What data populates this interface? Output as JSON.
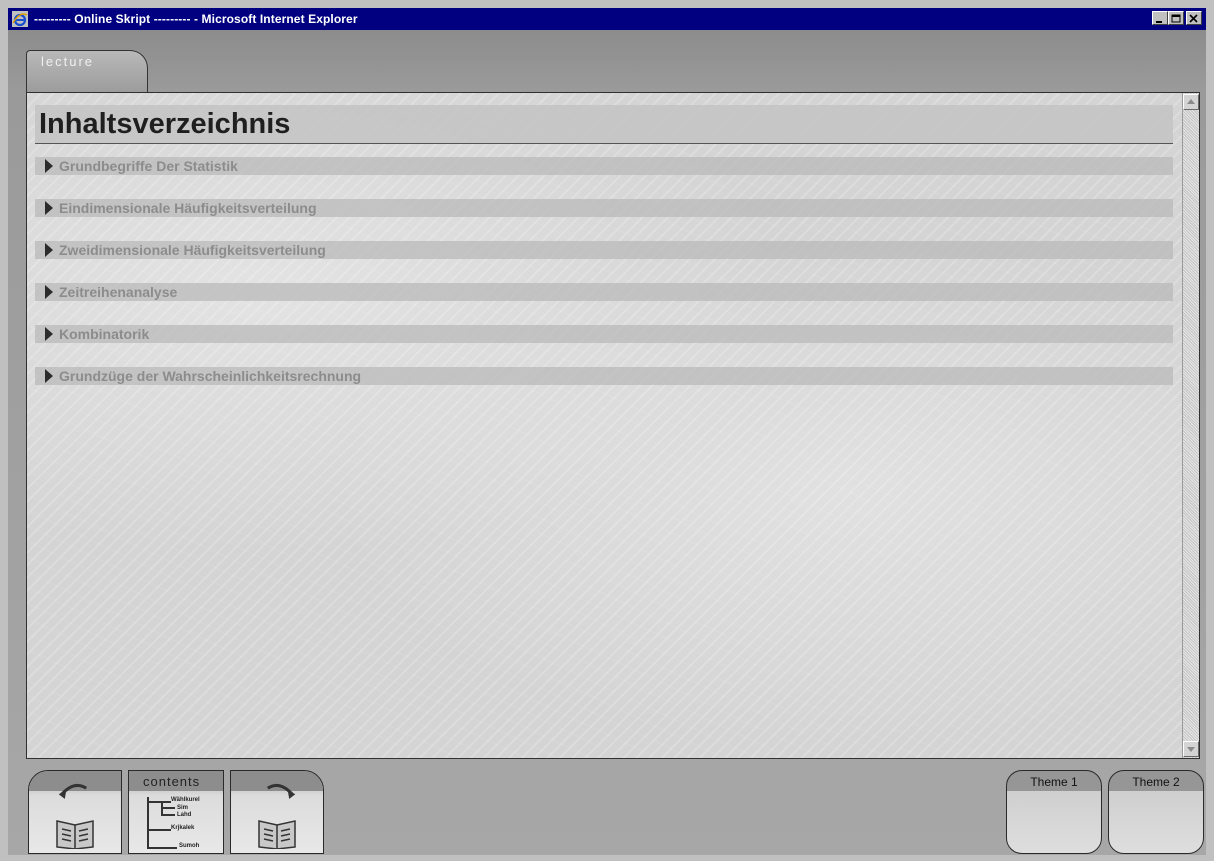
{
  "window": {
    "title": "--------- Online Skript --------- - Microsoft Internet Explorer",
    "icon": "ie-icon"
  },
  "tab": {
    "label": "lecture"
  },
  "page": {
    "heading": "Inhaltsverzeichnis",
    "toc": [
      "Grundbegriffe Der Statistik",
      "Eindimensionale Häufigkeitsverteilung",
      "Zweidimensionale Häufigkeitsverteilung",
      "Zeitreihenanalyse",
      "Kombinatorik",
      "Grundzüge der Wahrscheinlichkeitsrechnung"
    ]
  },
  "nav": {
    "contents_label": "contents",
    "tree_labels": [
      "Wählkurel",
      "Sim",
      "Lahd",
      "Krjkalek",
      "Sumoh"
    ]
  },
  "themes": {
    "theme1": "Theme 1",
    "theme2": "Theme 2"
  }
}
